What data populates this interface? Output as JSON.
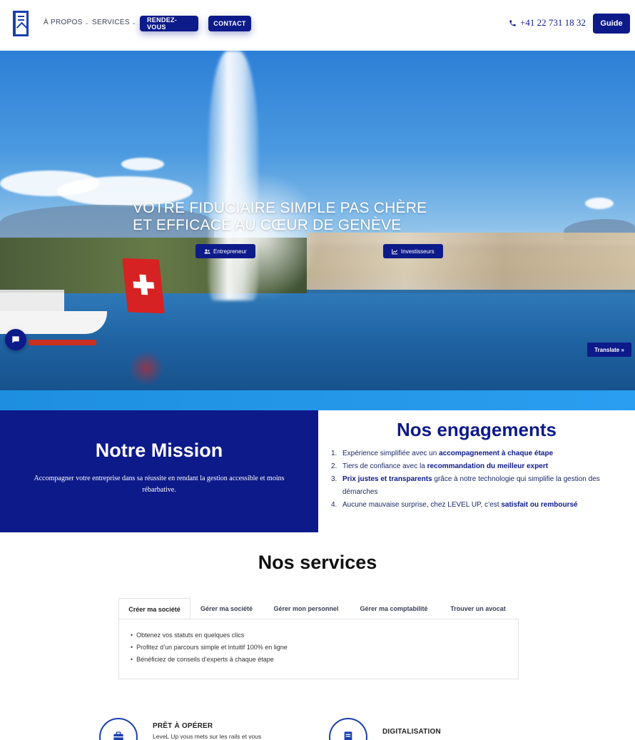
{
  "header": {
    "nav": [
      {
        "label": "À PROPOS"
      },
      {
        "label": "SERVICES"
      }
    ],
    "rdv_label": "RENDEZ-VOUS",
    "contact_label": "CONTACT",
    "phone": "+41 22 731 18 32",
    "guide_label": "Guide"
  },
  "hero": {
    "title": "VOTRE FIDUCIAIRE SIMPLE PAS CHÈRE ET EFFICACE AU CŒUR DE GENÈVE",
    "btn_entrepreneur": "Entrepreneur",
    "btn_investisseurs": "Investisseurs",
    "translate_label": "Translate »"
  },
  "mission": {
    "title": "Notre Mission",
    "text": "Accompagner votre entreprise dans sa réussite en rendant la gestion accessible et moins rébarbative."
  },
  "engagements": {
    "title": "Nos engagements",
    "items": [
      {
        "num": "1.",
        "pre": "Expérience simplifiée avec un ",
        "bold": "accompagnement à chaque étape",
        "post": ""
      },
      {
        "num": "2.",
        "pre": "Tiers de confiance avec la ",
        "bold": "recommandation du meilleur expert",
        "post": ""
      },
      {
        "num": "3.",
        "pre": "",
        "bold": "Prix justes et transparents",
        "post": " grâce à notre technologie qui simplifie la gestion des démarches"
      },
      {
        "num": "4.",
        "pre": "Aucune mauvaise surprise, chez LEVEL UP, c’est ",
        "bold": "satisfait ou remboursé",
        "post": ""
      }
    ]
  },
  "services": {
    "title": "Nos services",
    "tabs": [
      {
        "label": "Créer ma société"
      },
      {
        "label": "Gérer ma société"
      },
      {
        "label": "Gérer mon personnel"
      },
      {
        "label": "Gérer ma comptabilité"
      },
      {
        "label": "Trouver un avocat"
      }
    ],
    "active_items": [
      "Obtenez vos statuts en quelques clics",
      "Profitez d’un parcours simple et intuitif 100% en ligne",
      "Bénéficiez de conseils d’experts à chaque étape"
    ]
  },
  "features": [
    {
      "title": "PRÊT À OPÉRER",
      "text": "LeveL Up vous mets sur les rails et vous",
      "icon": "briefcase-icon"
    },
    {
      "title": "DIGITALISATION",
      "text": "",
      "icon": "document-icon"
    }
  ],
  "colors": {
    "primary": "#0d1a8a",
    "accent": "#1a3fb0",
    "band": "#1e8fe0"
  }
}
